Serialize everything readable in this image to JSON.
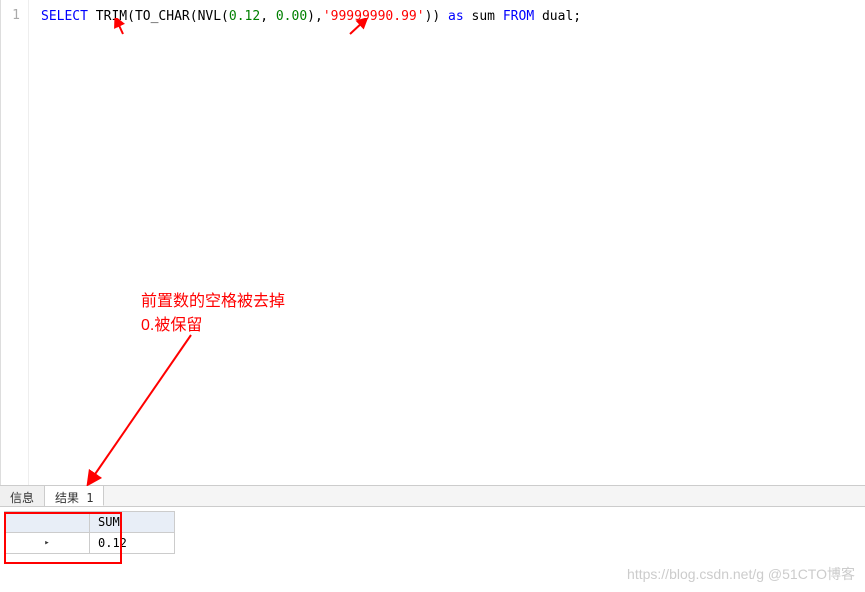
{
  "editor": {
    "line_number": "1",
    "sql": {
      "select": "SELECT",
      "trim": "TRIM",
      "to_char": "TO_CHAR",
      "nvl": "NVL",
      "arg1": "0.12",
      "arg2": "0.00",
      "fmt": "'99999990.99'",
      "as": "as",
      "alias": "sum",
      "from": "FROM",
      "table": "dual;"
    }
  },
  "annotation": {
    "line1": "前置数的空格被去掉",
    "line2": "0.被保留"
  },
  "tabs": {
    "info": "信息",
    "result1": "结果 1"
  },
  "result": {
    "column_header": "SUM",
    "row_value": "0.12",
    "row_marker": "▸"
  },
  "watermark": "https://blog.csdn.net/g @51CTO博客"
}
